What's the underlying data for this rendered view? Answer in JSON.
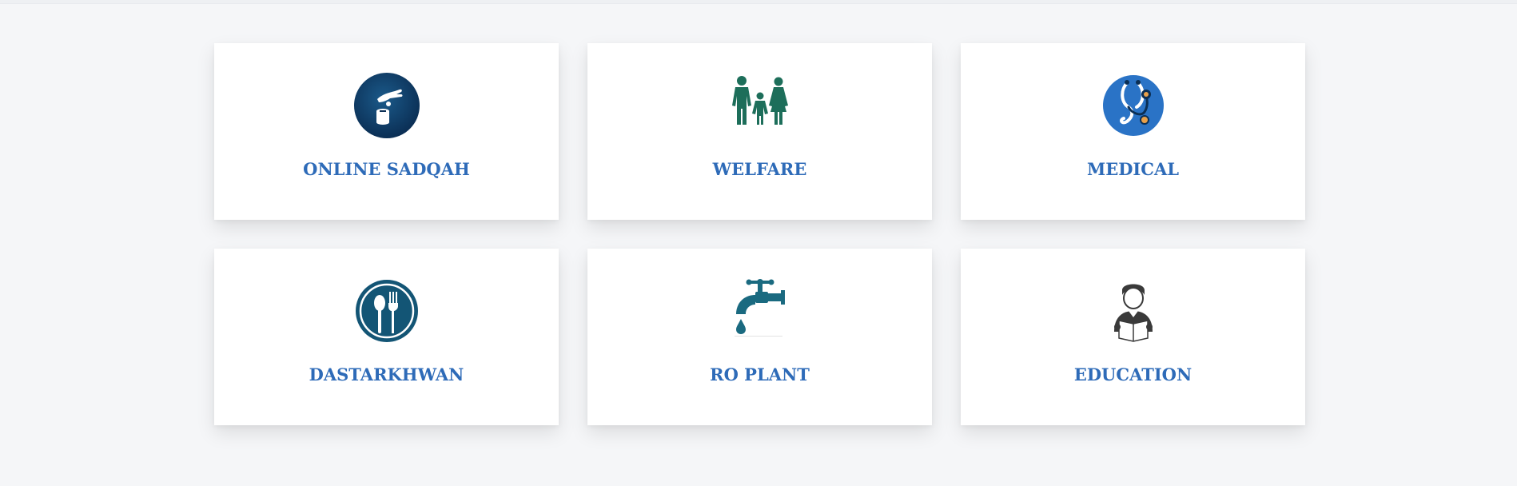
{
  "colors": {
    "background": "#f5f6f8",
    "card": "#ffffff",
    "label": "#2e6bb8"
  },
  "cards": [
    {
      "label": "ONLINE SADQAH",
      "icon": "donation-box-icon"
    },
    {
      "label": "WELFARE",
      "icon": "family-icon"
    },
    {
      "label": "MEDICAL",
      "icon": "stethoscope-icon"
    },
    {
      "label": "DASTARKHWAN",
      "icon": "spoon-fork-icon"
    },
    {
      "label": "RO PLANT",
      "icon": "water-tap-icon"
    },
    {
      "label": "EDUCATION",
      "icon": "student-reading-icon"
    }
  ]
}
